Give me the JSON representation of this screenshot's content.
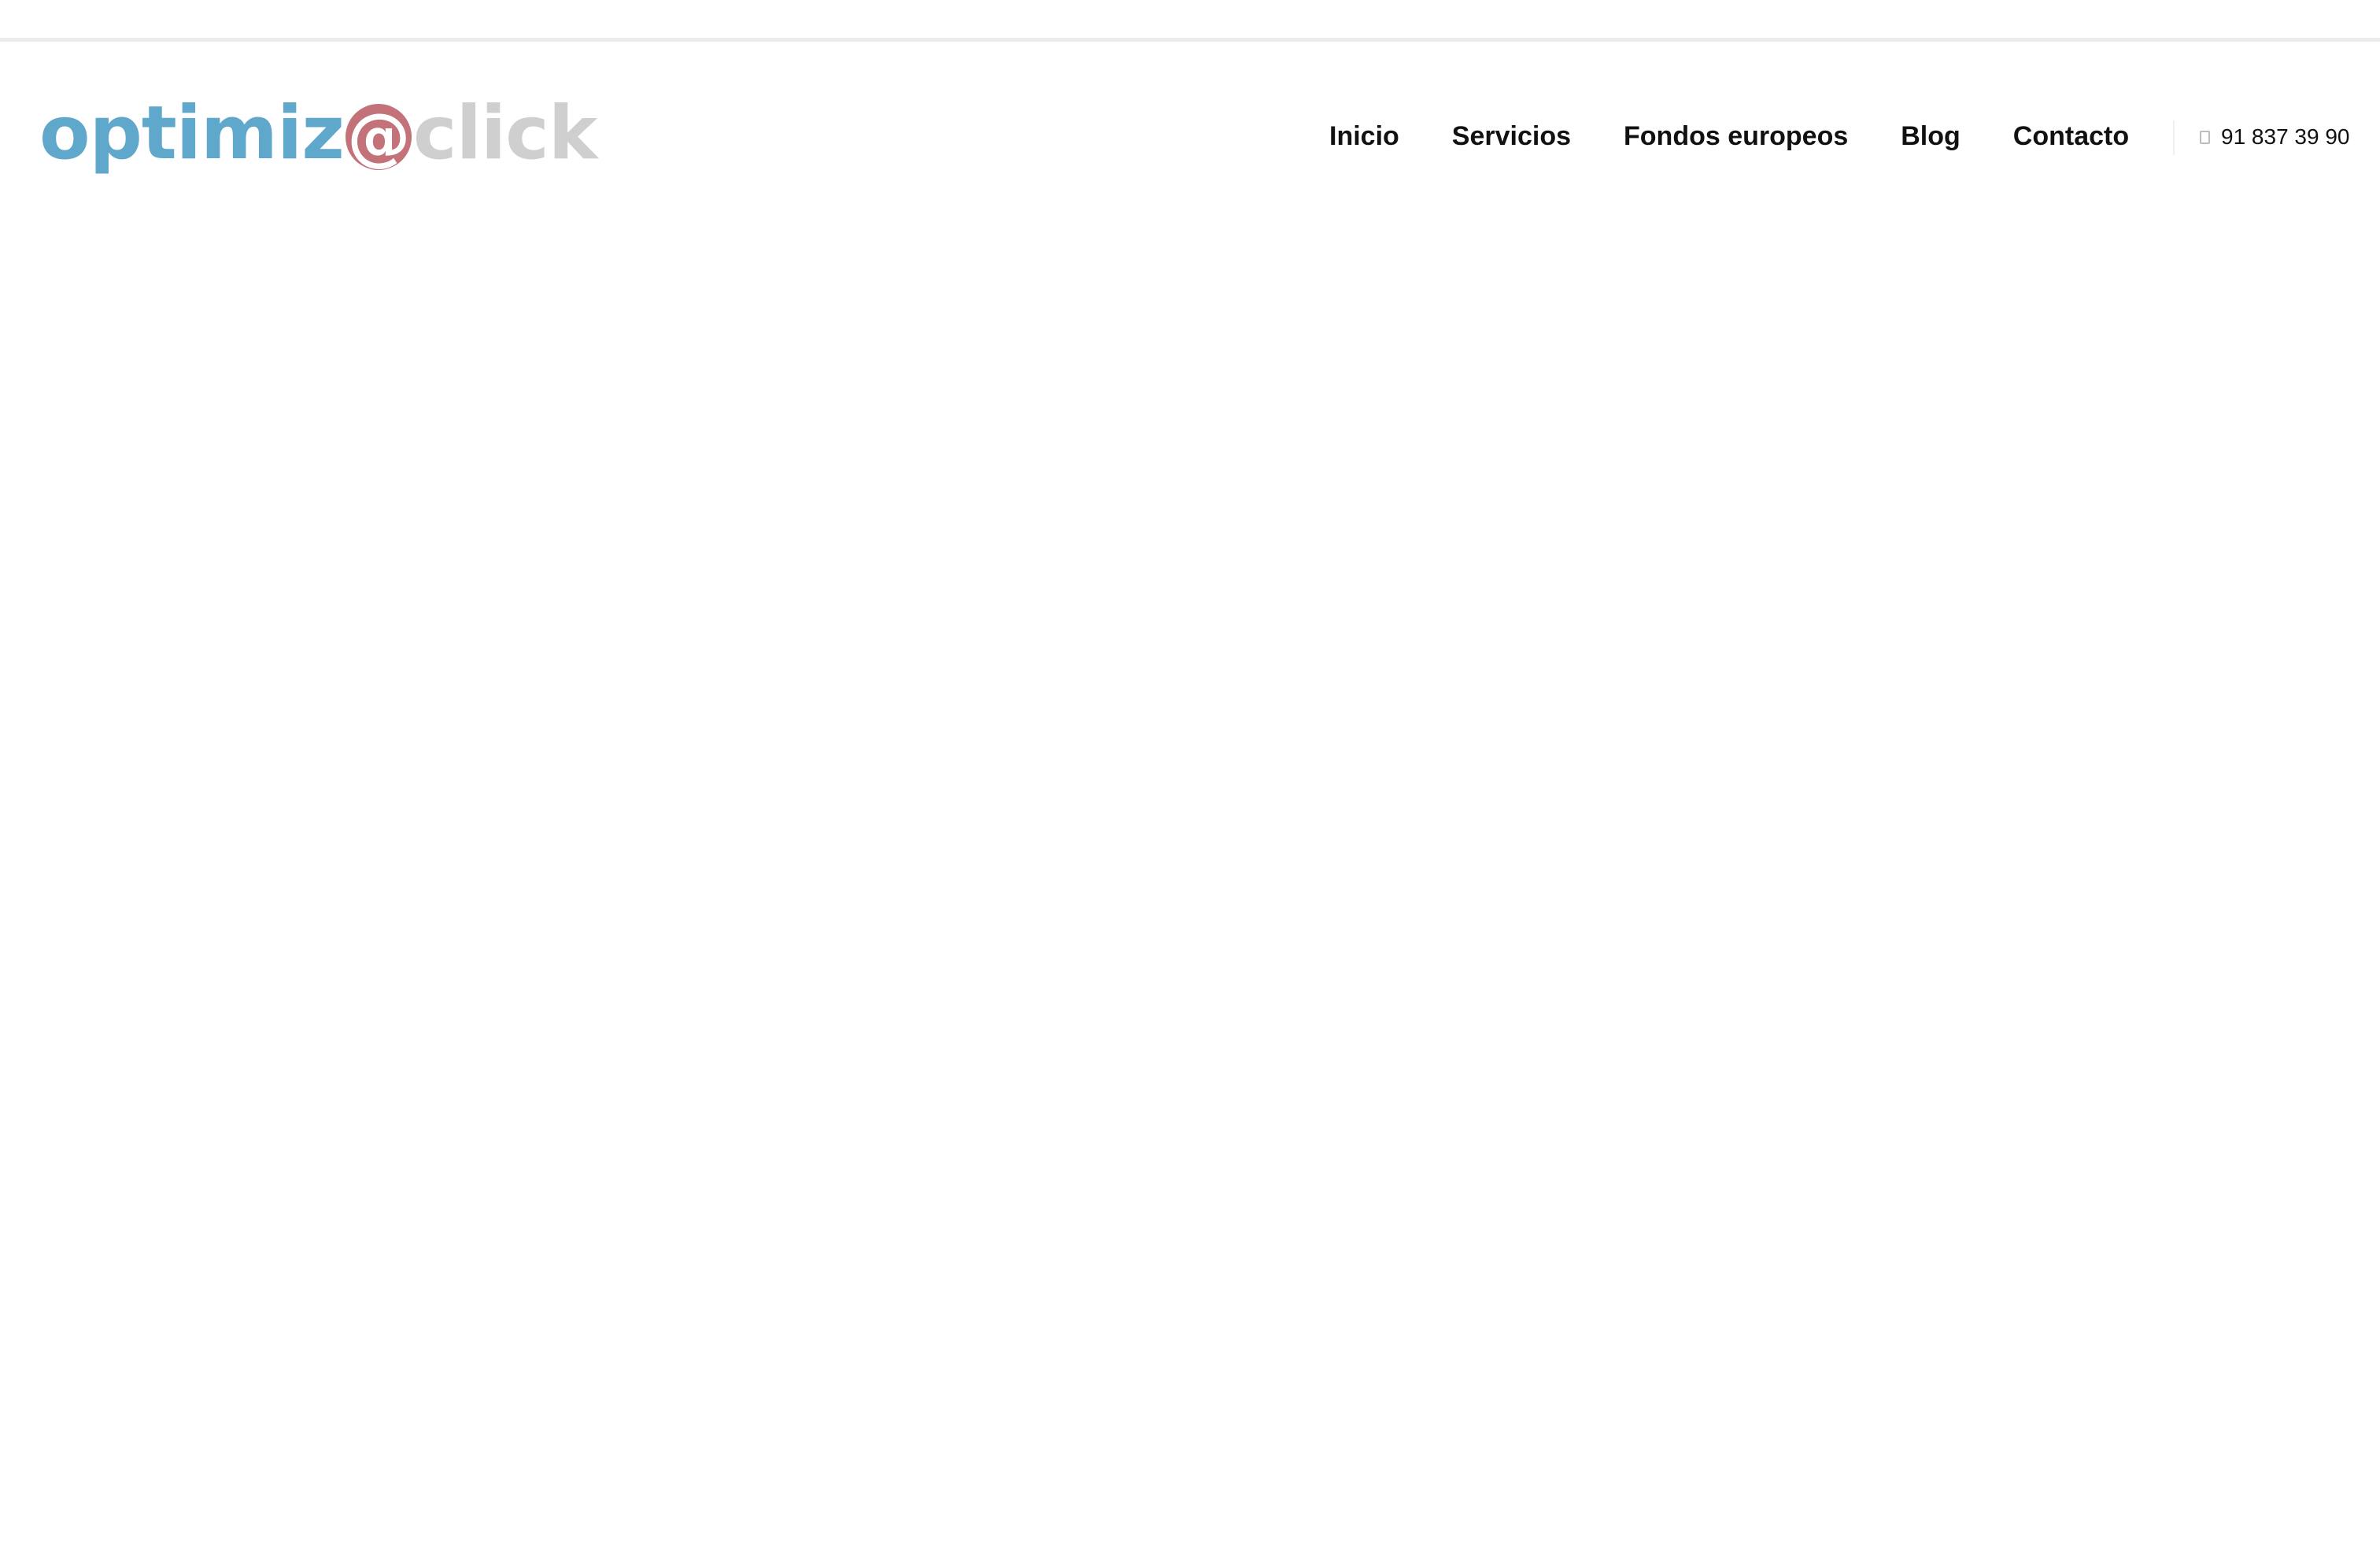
{
  "brand": {
    "logo_part_a": "optimiz",
    "logo_part_b": "@",
    "logo_part_c": "click",
    "colors": {
      "blue": "#5fa8cc",
      "red": "#c27278",
      "gray": "#cfcfcf"
    }
  },
  "nav": {
    "items": [
      {
        "label": "Inicio"
      },
      {
        "label": "Servicios"
      },
      {
        "label": "Fondos europeos"
      },
      {
        "label": "Blog"
      },
      {
        "label": "Contacto"
      }
    ]
  },
  "contact": {
    "phone_icon": "phone-icon",
    "phone": "91 837 39 90"
  }
}
